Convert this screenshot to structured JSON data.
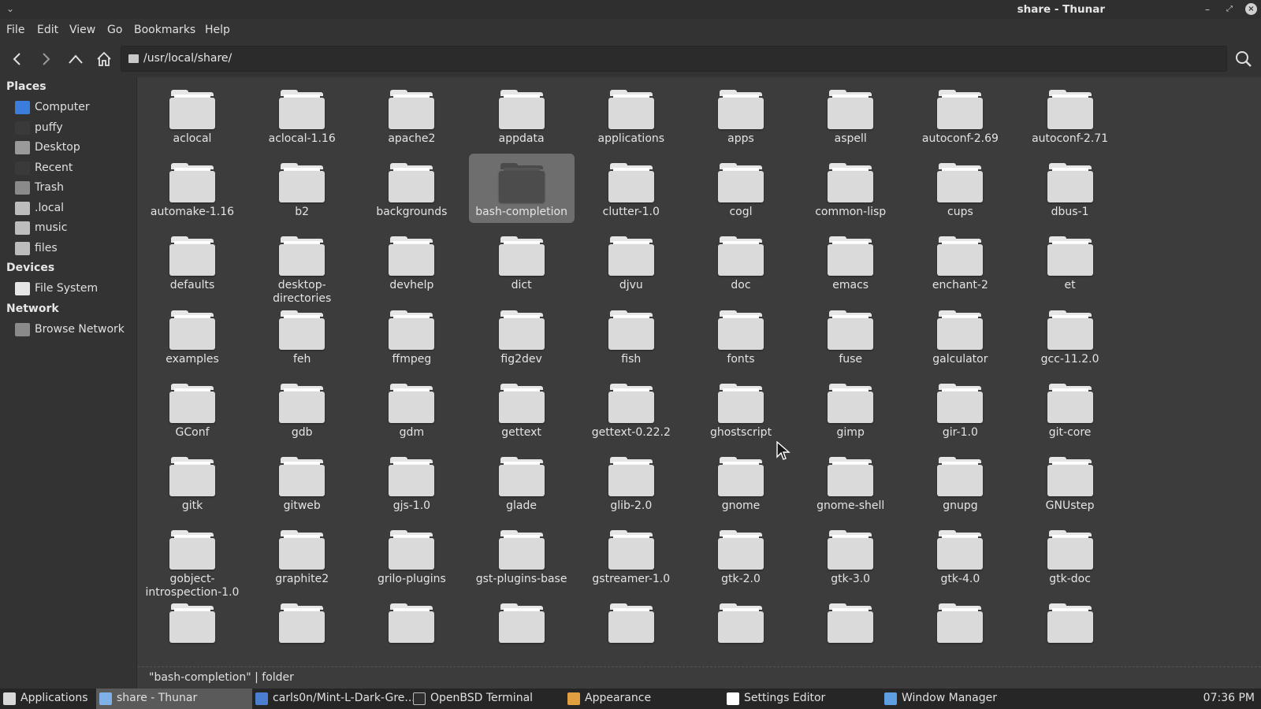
{
  "window": {
    "title": "share - Thunar",
    "controls": {
      "menu": "⌄",
      "minimize": "–",
      "maximize": "⤢",
      "close": "×"
    }
  },
  "menubar": [
    "File",
    "Edit",
    "View",
    "Go",
    "Bookmarks",
    "Help"
  ],
  "toolbar": {
    "path": "/usr/local/share/",
    "icons": [
      "back-icon",
      "forward-icon",
      "up-icon",
      "home-icon",
      "search-icon"
    ]
  },
  "sidebar": {
    "sections": [
      {
        "heading": "Places",
        "items": [
          {
            "label": "Computer",
            "icon": "computer-icon",
            "color": "#3b7ddd"
          },
          {
            "label": "puffy",
            "icon": "user-home-icon",
            "color": "#3a3a3a"
          },
          {
            "label": "Desktop",
            "icon": "desktop-icon",
            "color": "#9a9a9a"
          },
          {
            "label": "Recent",
            "icon": "recent-icon",
            "color": "#3a3a3a"
          },
          {
            "label": "Trash",
            "icon": "trash-icon",
            "color": "#8a8a8a"
          },
          {
            "label": ".local",
            "icon": "folder-icon",
            "color": "#bdbdbd"
          },
          {
            "label": "music",
            "icon": "folder-icon",
            "color": "#bdbdbd"
          },
          {
            "label": "files",
            "icon": "folder-icon",
            "color": "#bdbdbd"
          }
        ]
      },
      {
        "heading": "Devices",
        "items": [
          {
            "label": "File System",
            "icon": "drive-icon",
            "color": "#e6e6e6"
          }
        ]
      },
      {
        "heading": "Network",
        "items": [
          {
            "label": "Browse Network",
            "icon": "network-icon",
            "color": "#8a8a8a"
          }
        ]
      }
    ]
  },
  "files": [
    "aclocal",
    "aclocal-1.16",
    "apache2",
    "appdata",
    "applications",
    "apps",
    "aspell",
    "autoconf-2.69",
    "autoconf-2.71",
    "automake-1.16",
    "b2",
    "backgrounds",
    "bash-completion",
    "clutter-1.0",
    "cogl",
    "common-lisp",
    "cups",
    "dbus-1",
    "defaults",
    "desktop-directories",
    "devhelp",
    "dict",
    "djvu",
    "doc",
    "emacs",
    "enchant-2",
    "et",
    "examples",
    "feh",
    "ffmpeg",
    "fig2dev",
    "fish",
    "fonts",
    "fuse",
    "galculator",
    "gcc-11.2.0",
    "GConf",
    "gdb",
    "gdm",
    "gettext",
    "gettext-0.22.2",
    "ghostscript",
    "gimp",
    "gir-1.0",
    "git-core",
    "gitk",
    "gitweb",
    "gjs-1.0",
    "glade",
    "glib-2.0",
    "gnome",
    "gnome-shell",
    "gnupg",
    "GNUstep",
    "gobject-introspection-1.0",
    "graphite2",
    "grilo-plugins",
    "gst-plugins-base",
    "gstreamer-1.0",
    "gtk-2.0",
    "gtk-3.0",
    "gtk-4.0",
    "gtk-doc",
    "",
    "",
    "",
    "",
    "",
    "",
    "",
    "",
    ""
  ],
  "selected_file": "bash-completion",
  "status": "\"bash-completion\"  |  folder",
  "taskbar": {
    "items": [
      {
        "label": "Applications",
        "icon": "applications-menu-icon",
        "active": false
      },
      {
        "label": "share - Thunar",
        "icon": "thunar-folder-icon",
        "active": true
      },
      {
        "label": "carls0n/Mint-L-Dark-Gre...",
        "icon": "browser-icon",
        "active": false
      },
      {
        "label": "OpenBSD Terminal",
        "icon": "terminal-icon",
        "active": false
      },
      {
        "label": "Appearance",
        "icon": "appearance-icon",
        "active": false
      },
      {
        "label": "Settings Editor",
        "icon": "settings-editor-icon",
        "active": false
      },
      {
        "label": "Window Manager",
        "icon": "window-manager-icon",
        "active": false
      }
    ],
    "clock": "07:36 PM"
  }
}
